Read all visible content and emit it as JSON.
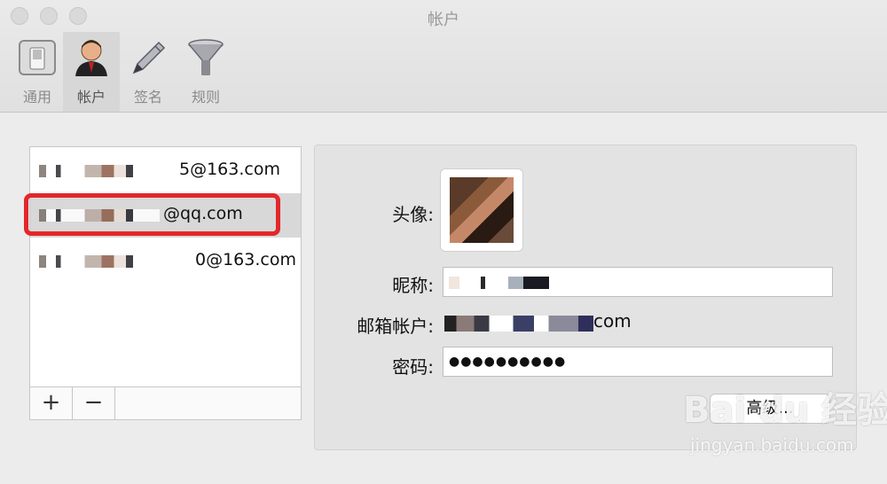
{
  "window": {
    "title": "帐户"
  },
  "toolbar": {
    "items": [
      {
        "label": "通用",
        "icon": "switch-icon"
      },
      {
        "label": "帐户",
        "icon": "user-icon",
        "selected": true
      },
      {
        "label": "签名",
        "icon": "pen-icon"
      },
      {
        "label": "规则",
        "icon": "funnel-icon"
      }
    ]
  },
  "accounts": {
    "items": [
      {
        "label": "5@163.com"
      },
      {
        "label": "@qq.com",
        "selected": true
      },
      {
        "label": "0@163.com"
      }
    ],
    "add_label": "+",
    "remove_label": "−"
  },
  "details": {
    "avatar_label": "头像:",
    "nickname_label": "昵称:",
    "email_label": "邮箱帐户:",
    "email_value": "com",
    "password_label": "密码:",
    "password_value": "●●●●●●●●●●",
    "advanced_label": "高级..."
  },
  "watermark": {
    "brand": "Bai du 经验",
    "url": "jingyan.baidu.com"
  },
  "colors": {
    "highlight": "#e2272a",
    "selected_row": "#d8d8d8"
  }
}
